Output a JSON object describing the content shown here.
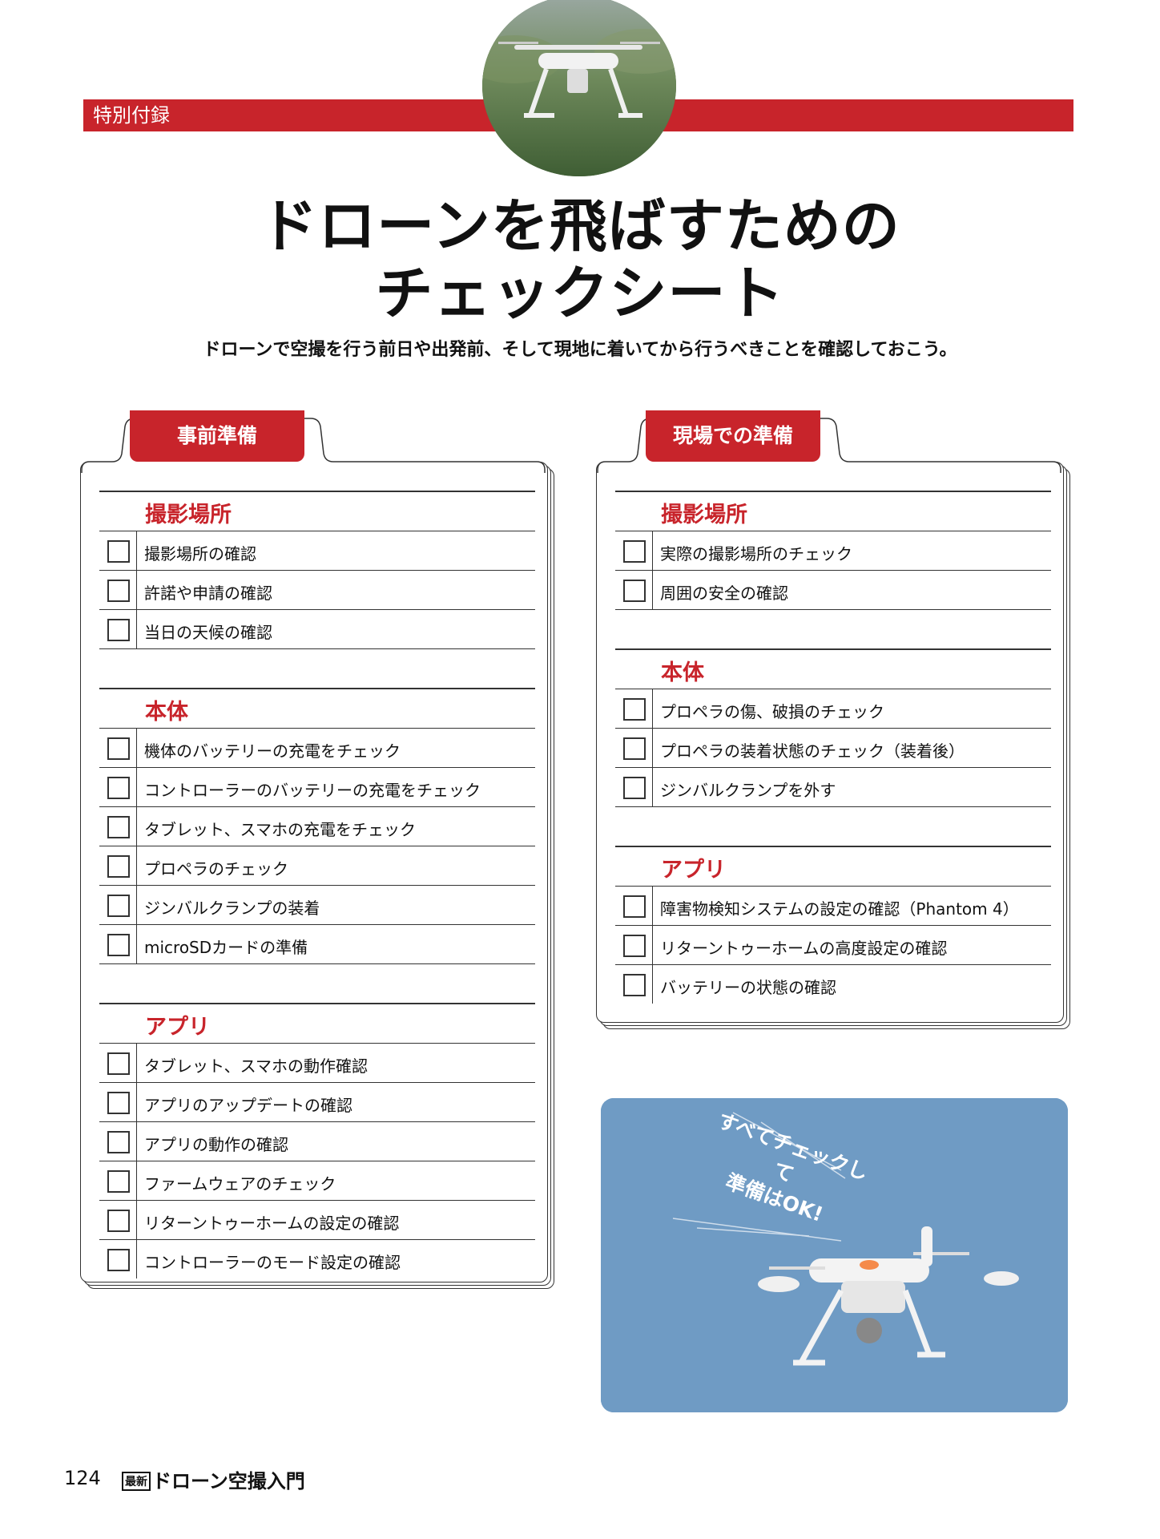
{
  "header": {
    "section_tag": "特別付録",
    "title_line1": "ドローンを飛ばすための",
    "title_line2": "チェックシート",
    "subtitle": "ドローンで空撮を行う前日や出発前、そして現地に着いてから行うべきことを確認しておこう。"
  },
  "left_card": {
    "tab": "事前準備",
    "groups": [
      {
        "title": "撮影場所",
        "items": [
          "撮影場所の確認",
          "許諾や申請の確認",
          "当日の天候の確認"
        ]
      },
      {
        "title": "本体",
        "items": [
          "機体のバッテリーの充電をチェック",
          "コントローラーのバッテリーの充電をチェック",
          "タブレット、スマホの充電をチェック",
          "プロペラのチェック",
          "ジンバルクランプの装着",
          "microSDカードの準備"
        ]
      },
      {
        "title": "アプリ",
        "items": [
          "タブレット、スマホの動作確認",
          "アプリのアップデートの確認",
          "アプリの動作の確認",
          "ファームウェアのチェック",
          "リターントゥーホームの設定の確認",
          "コントローラーのモード設定の確認"
        ]
      }
    ]
  },
  "right_card": {
    "tab": "現場での準備",
    "groups": [
      {
        "title": "撮影場所",
        "items": [
          "実際の撮影場所のチェック",
          "周囲の安全の確認"
        ]
      },
      {
        "title": "本体",
        "items": [
          "プロペラの傷、破損のチェック",
          "プロペラの装着状態のチェック（装着後）",
          "ジンバルクランプを外す"
        ]
      },
      {
        "title": "アプリ",
        "items": [
          "障害物検知システムの設定の確認（Phantom 4）",
          "リターントゥーホームの高度設定の確認",
          "バッテリーの状態の確認"
        ]
      }
    ]
  },
  "photo": {
    "caption_line1": "すべてチェックして",
    "caption_line2": "準備はOK!"
  },
  "footer": {
    "page_number": "124",
    "book_badge": "最新",
    "book_title": "ドローン空撮入門"
  },
  "colors": {
    "accent": "#c8242b",
    "sky": "#6f9bc4"
  }
}
